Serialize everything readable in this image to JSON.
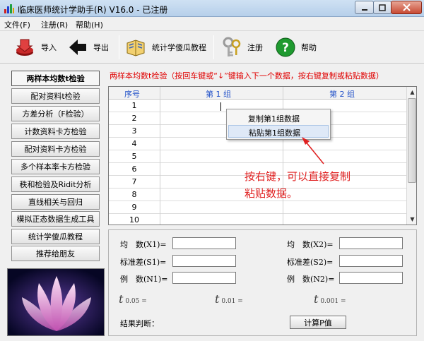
{
  "window": {
    "title": "临床医师统计学助手(R) V16.0 - 已注册"
  },
  "menu": [
    {
      "label": "文件(F)"
    },
    {
      "label": "注册(R)"
    },
    {
      "label": "帮助(H)"
    }
  ],
  "toolbar": {
    "import_label": "导入",
    "export_label": "导出",
    "tutorial_label": "统计学傻瓜教程",
    "register_label": "注册",
    "help_label": "帮助"
  },
  "nav": [
    {
      "label": "两样本均数t检验",
      "active": true
    },
    {
      "label": "配对资料t检验"
    },
    {
      "label": "方差分析（F检验）"
    },
    {
      "label": "计数资料卡方检验"
    },
    {
      "label": "配对资料卡方检验"
    },
    {
      "label": "多个样本率卡方检验"
    },
    {
      "label": "秩和检验及Ridit分析"
    },
    {
      "label": "直线相关与回归"
    },
    {
      "label": "模拟正态数据生成工具"
    },
    {
      "label": "统计学傻瓜教程"
    },
    {
      "label": "推荐给朋友"
    }
  ],
  "hint": "两样本均数t检验（按回车键或“↓”键输入下一个数据，按右键复制或粘贴数据）",
  "grid": {
    "headers": [
      "序号",
      "第 1 组",
      "第 2 组"
    ],
    "rows": [
      "1",
      "2",
      "3",
      "4",
      "5",
      "6",
      "7",
      "8",
      "9",
      "10"
    ]
  },
  "context_menu": [
    {
      "label": "复制第1组数据"
    },
    {
      "label": "粘贴第1组数据",
      "highlighted": true
    }
  ],
  "annotation": {
    "line1": "按右键，可以直接复制",
    "line2": "粘贴数据。"
  },
  "stats": {
    "mean1": "均　数(X1)=",
    "mean2": "均　数(X2)=",
    "sd1": "标准差(S1)=",
    "sd2": "标准差(S2)=",
    "n1": "例　数(N1)=",
    "n2": "例　数(N2)=",
    "t": "t",
    "t005_sub": "0.05 =",
    "t001_sub": "0.01 =",
    "t0001_sub": "0.001 =",
    "result_label": "结果判断：",
    "calc_button": "计算P值"
  },
  "colors": {
    "hint_red": "#e00000",
    "header_blue": "#2050c8",
    "annotation_red": "#e02020"
  }
}
